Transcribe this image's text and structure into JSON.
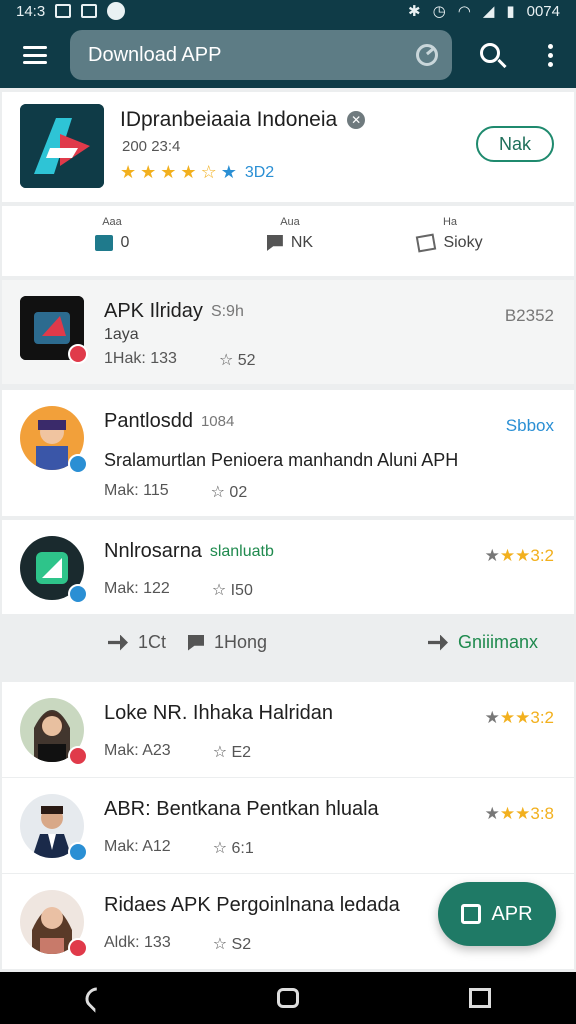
{
  "status_bar": {
    "time": "14:3",
    "right_text": "0074"
  },
  "app_bar": {
    "search_value": "Download APP"
  },
  "hero": {
    "title": "IDpranbeiaaia Indoneia",
    "subtitle": "200 23:4",
    "rating_value": "3D2",
    "action_label": "Nak"
  },
  "stats": [
    {
      "label": "Aaa",
      "value": "0"
    },
    {
      "label": "Aua",
      "value": "NK"
    },
    {
      "label": "Ha",
      "value": "Sioky"
    }
  ],
  "items": [
    {
      "title": "APK Ilriday",
      "title_extra": "S:9h",
      "subline": "1aya",
      "meta_a": "1Hak: 133",
      "meta_b": "52",
      "right": "B2352"
    },
    {
      "title": "Pantlosdd",
      "title_extra": "1084",
      "subline": "Sralamurtlan Penioera manhandn Aluni APH",
      "meta_a": "Mak: 115",
      "meta_b": "02",
      "right": "Sbbox"
    },
    {
      "title": "Nnlrosarna",
      "title_extra": "slanluatb",
      "meta_a": "Mak: 122",
      "meta_b": "I50",
      "right": "3:2"
    },
    {
      "title": "Loke NR. Ihhaka Halridan",
      "meta_a": "Mak: A23",
      "meta_b": "E2",
      "right": "3:2"
    },
    {
      "title": "ABR: Bentkana Pentkan hluala",
      "meta_a": "Mak: A12",
      "meta_b": "6:1",
      "right": "3:8"
    },
    {
      "title": "Ridaes APK Pergoinlnana ledada",
      "meta_a": "Aldk: 133",
      "meta_b": "S2"
    }
  ],
  "action_bar": {
    "a": "1Ct",
    "b": "1Hong",
    "c": "Gniiimanx"
  },
  "fab_label": "APR",
  "colors": {
    "primary": "#0f3b47",
    "accent": "#1f7a66",
    "star": "#f2b01e",
    "link": "#2a8fd4"
  }
}
